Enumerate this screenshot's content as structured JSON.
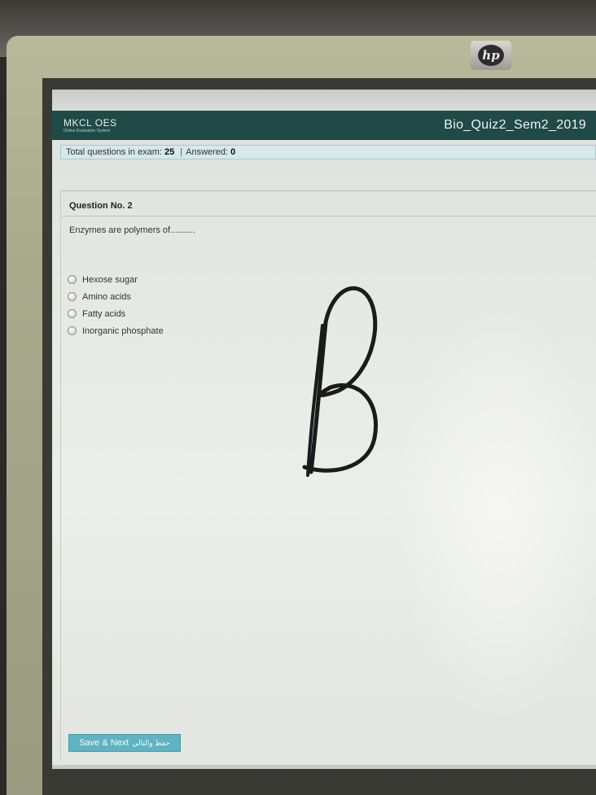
{
  "monitor": {
    "logo_text": "hp"
  },
  "app": {
    "brand_name": "MKCL OES",
    "brand_sub": "Online Evaluation System",
    "exam_title": "Bio_Quiz2_Sem2_2019"
  },
  "stats": {
    "total_label": "Total questions in exam:",
    "total_value": "25",
    "separator": "|",
    "answered_label": "Answered:",
    "answered_value": "0"
  },
  "question": {
    "number_label": "Question No. 2",
    "text": "Enzymes are polymers of..........",
    "options": [
      {
        "label": "Hexose sugar"
      },
      {
        "label": "Amino acids"
      },
      {
        "label": "Fatty acids"
      },
      {
        "label": "Inorganic phosphate"
      }
    ]
  },
  "actions": {
    "save_next_label": "Save & Next",
    "save_next_label_ar": "حفظ والتالي"
  },
  "annotation": {
    "handwritten_letter": "B"
  },
  "colors": {
    "header_bg": "#1f4a47",
    "stats_bg": "#d6e8ea",
    "button_bg": "#5fb3c2"
  }
}
